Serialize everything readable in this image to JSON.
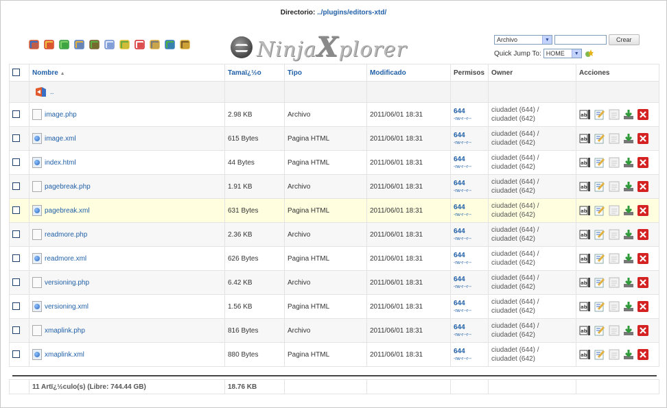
{
  "directory": {
    "label": "Directorio:",
    "path": "../plugins/editors-xtd/"
  },
  "toolbar": [
    "back-icon",
    "home-icon",
    "reload-icon",
    "search-icon",
    "archive-icon",
    "copy-icon",
    "move-icon",
    "delete-icon",
    "rename-icon",
    "chmod-icon",
    "extract-icon"
  ],
  "logo": {
    "first": "Ninja",
    "big": "X",
    "rest": "plorer"
  },
  "quick": {
    "type_select": "Archivo",
    "create_button": "Crear",
    "jump_label": "Quick Jump To:",
    "jump_select": "HOME"
  },
  "columns": {
    "name": "Nombre",
    "size": "Tamaï¿½o",
    "type": "Tipo",
    "modified": "Modificado",
    "perms": "Permisos",
    "owner": "Owner",
    "actions": "Acciones"
  },
  "sort_indicator": "▲",
  "up_label": "..",
  "files": [
    {
      "name": "image.php",
      "size": "2.98 KB",
      "type": "Archivo",
      "modified": "2011/06/01 18:31",
      "perm": "644",
      "perm_str": "-rw-r--r--",
      "owner": "ciudadet (644) /",
      "group": "ciudadet (642)",
      "icon": "php"
    },
    {
      "name": "image.xml",
      "size": "615 Bytes",
      "type": "Pagina HTML",
      "modified": "2011/06/01 18:31",
      "perm": "644",
      "perm_str": "-rw-r--r--",
      "owner": "ciudadet (644) /",
      "group": "ciudadet (642)",
      "icon": "web"
    },
    {
      "name": "index.html",
      "size": "44 Bytes",
      "type": "Pagina HTML",
      "modified": "2011/06/01 18:31",
      "perm": "644",
      "perm_str": "-rw-r--r--",
      "owner": "ciudadet (644) /",
      "group": "ciudadet (642)",
      "icon": "web"
    },
    {
      "name": "pagebreak.php",
      "size": "1.91 KB",
      "type": "Archivo",
      "modified": "2011/06/01 18:31",
      "perm": "644",
      "perm_str": "-rw-r--r--",
      "owner": "ciudadet (644) /",
      "group": "ciudadet (642)",
      "icon": "php"
    },
    {
      "name": "pagebreak.xml",
      "size": "631 Bytes",
      "type": "Pagina HTML",
      "modified": "2011/06/01 18:31",
      "perm": "644",
      "perm_str": "-rw-r--r--",
      "owner": "ciudadet (644) /",
      "group": "ciudadet (642)",
      "icon": "web"
    },
    {
      "name": "readmore.php",
      "size": "2.36 KB",
      "type": "Archivo",
      "modified": "2011/06/01 18:31",
      "perm": "644",
      "perm_str": "-rw-r--r--",
      "owner": "ciudadet (644) /",
      "group": "ciudadet (642)",
      "icon": "php"
    },
    {
      "name": "readmore.xml",
      "size": "626 Bytes",
      "type": "Pagina HTML",
      "modified": "2011/06/01 18:31",
      "perm": "644",
      "perm_str": "-rw-r--r--",
      "owner": "ciudadet (644) /",
      "group": "ciudadet (642)",
      "icon": "web"
    },
    {
      "name": "versioning.php",
      "size": "6.42 KB",
      "type": "Archivo",
      "modified": "2011/06/01 18:31",
      "perm": "644",
      "perm_str": "-rw-r--r--",
      "owner": "ciudadet (644) /",
      "group": "ciudadet (642)",
      "icon": "php"
    },
    {
      "name": "versioning.xml",
      "size": "1.56 KB",
      "type": "Pagina HTML",
      "modified": "2011/06/01 18:31",
      "perm": "644",
      "perm_str": "-rw-r--r--",
      "owner": "ciudadet (644) /",
      "group": "ciudadet (642)",
      "icon": "web"
    },
    {
      "name": "xmaplink.php",
      "size": "816 Bytes",
      "type": "Archivo",
      "modified": "2011/06/01 18:31",
      "perm": "644",
      "perm_str": "-rw-r--r--",
      "owner": "ciudadet (644) /",
      "group": "ciudadet (642)",
      "icon": "php"
    },
    {
      "name": "xmaplink.xml",
      "size": "880 Bytes",
      "type": "Pagina HTML",
      "modified": "2011/06/01 18:31",
      "perm": "644",
      "perm_str": "-rw-r--r--",
      "owner": "ciudadet (644) /",
      "group": "ciudadet (642)",
      "icon": "web"
    }
  ],
  "highlighted_row": 4,
  "row_actions": [
    "rename-icon",
    "edit-icon",
    "view-icon",
    "download-icon",
    "delete-icon"
  ],
  "footer": {
    "count": "11 Artï¿½culo(s) (Libre: 744.44 GB)",
    "total": "18.76 KB"
  }
}
